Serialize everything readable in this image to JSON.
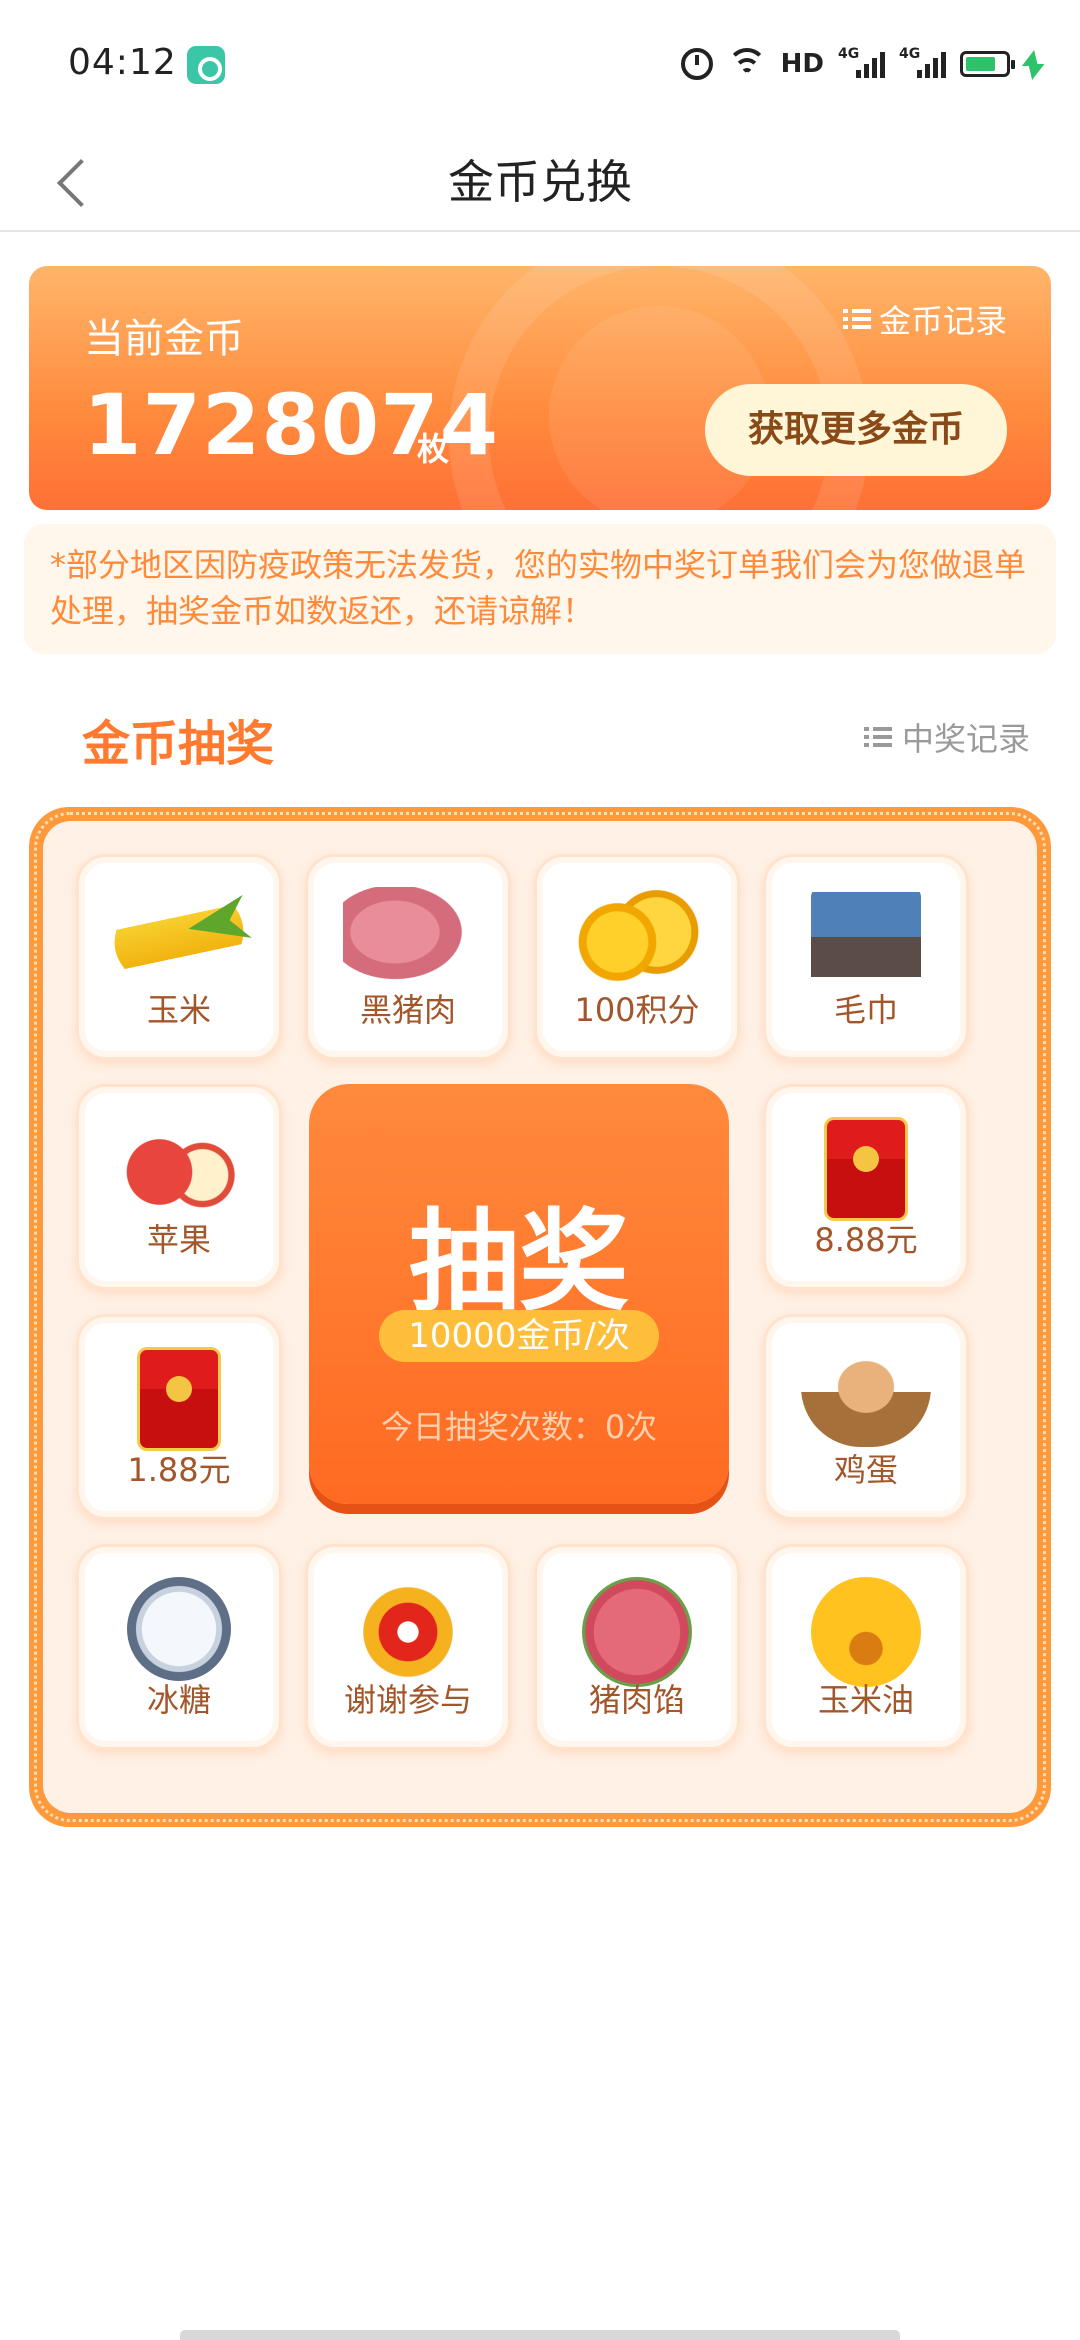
{
  "status_bar": {
    "time": "04:12",
    "hd_label": "HD",
    "net1": "4G",
    "net2": "4G"
  },
  "header": {
    "title": "金币兑换"
  },
  "coins": {
    "label": "当前金币",
    "value": "1728074",
    "unit": "枚",
    "record_link": "金币记录",
    "more_button": "获取更多金币"
  },
  "notice": {
    "text": "*部分地区因防疫政策无法发货，您的实物中奖订单我们会为您做退单处理，抽奖金币如数返还，还请谅解！"
  },
  "lottery": {
    "title": "金币抽奖",
    "record_link": "中奖记录",
    "draw_label": "抽奖",
    "draw_cost": "10000金币/次",
    "draw_count": "今日抽奖次数：0次",
    "prizes": [
      {
        "name": "玉米",
        "icon": "corn-icon"
      },
      {
        "name": "黑猪肉",
        "icon": "pork-icon"
      },
      {
        "name": "100积分",
        "icon": "points-coin-icon"
      },
      {
        "name": "毛巾",
        "icon": "towel-icon"
      },
      {
        "name": "苹果",
        "icon": "apple-icon"
      },
      {
        "name": "8.88元",
        "icon": "red-packet-icon"
      },
      {
        "name": "1.88元",
        "icon": "red-packet-icon"
      },
      {
        "name": "鸡蛋",
        "icon": "egg-basket-icon"
      },
      {
        "name": "冰糖",
        "icon": "rock-sugar-icon"
      },
      {
        "name": "谢谢参与",
        "icon": "thanks-icon"
      },
      {
        "name": "猪肉馅",
        "icon": "minced-pork-icon"
      },
      {
        "name": "玉米油",
        "icon": "corn-oil-icon"
      }
    ]
  },
  "colors": {
    "accent": "#ff7a2e",
    "card_top": "#ffb56a",
    "card_bottom": "#ff7035",
    "notice_text": "#ff8a3a",
    "board": "#ff9a3c"
  }
}
